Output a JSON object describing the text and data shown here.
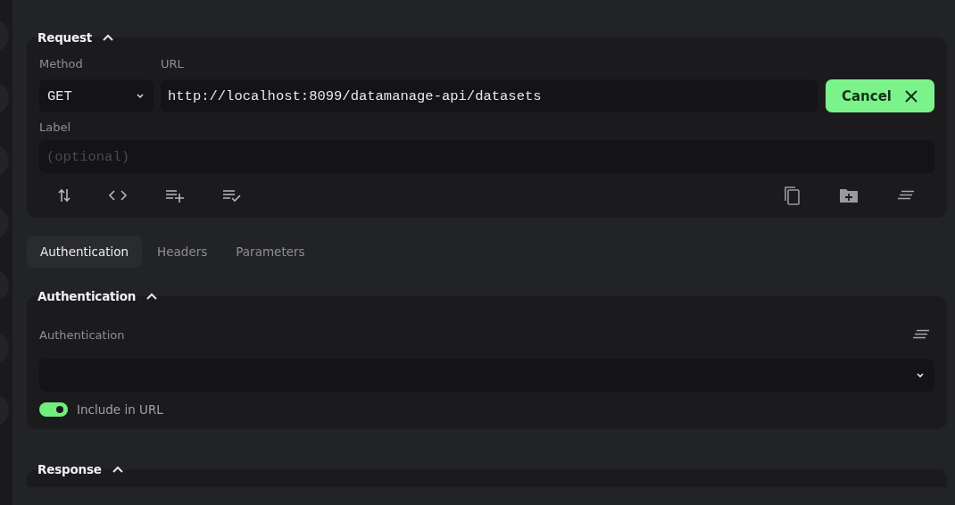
{
  "request": {
    "title": "Request",
    "expanded": true,
    "method": {
      "label": "Method",
      "value": "GET"
    },
    "url": {
      "label": "URL",
      "value": "http://localhost:8099/datamanage-api/datasets"
    },
    "cancel_button": "Cancel",
    "label_field": {
      "label": "Label",
      "placeholder": "(optional)"
    }
  },
  "tabs": [
    {
      "label": "Authentication",
      "selected": true
    },
    {
      "label": "Headers",
      "selected": false
    },
    {
      "label": "Parameters",
      "selected": false
    }
  ],
  "authentication": {
    "title": "Authentication",
    "expanded": true,
    "field_label": "Authentication",
    "include_in_url": {
      "label": "Include in URL",
      "on": true
    }
  },
  "response": {
    "title": "Response",
    "expanded": true
  }
}
